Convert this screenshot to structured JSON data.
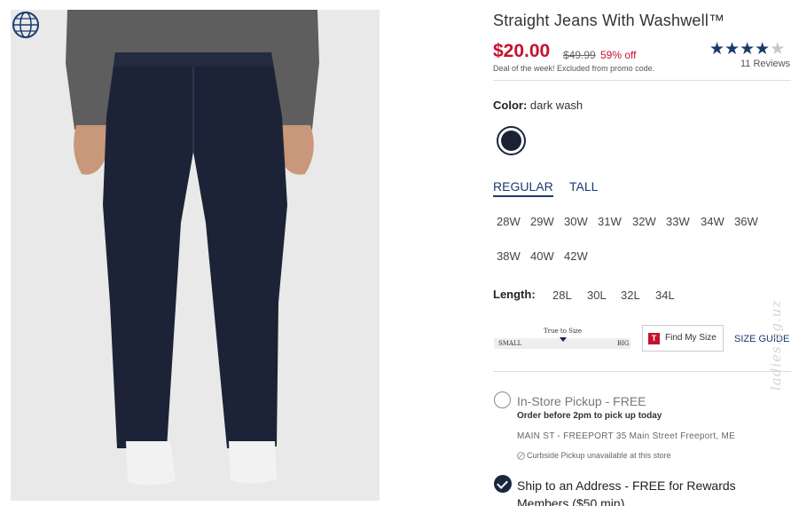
{
  "product": {
    "title": "Straight Jeans With Washwell™",
    "price": "$20.00",
    "original_price": "$49.99",
    "discount": "59% off",
    "deal_note": "Deal of the week! Excluded from promo code.",
    "rating_stars": 4.5,
    "reviews": "11 Reviews"
  },
  "color": {
    "label": "Color:",
    "value": "dark wash",
    "swatch_hex": "#1b2233"
  },
  "fit_tabs": [
    {
      "label": "REGULAR",
      "active": true
    },
    {
      "label": "TALL",
      "active": false
    }
  ],
  "waist_sizes": [
    "28W",
    "29W",
    "30W",
    "31W",
    "32W",
    "33W",
    "34W",
    "36W",
    "38W",
    "40W",
    "42W"
  ],
  "length": {
    "label": "Length:",
    "sizes": [
      "28L",
      "30L",
      "32L",
      "34L"
    ]
  },
  "fit_meter": {
    "label": "True to Size",
    "min_label": "SMALL",
    "max_label": "BIG"
  },
  "find_my_size": {
    "icon_letter": "T",
    "label": "Find My Size"
  },
  "size_guide": "SIZE GUIDE",
  "pickup": {
    "title": "In-Store Pickup - FREE",
    "note": "Order before 2pm to pick up today",
    "address": "MAIN ST - FREEPORT 35 Main Street  Freeport, ME",
    "curbside": "Curbside Pickup unavailable at this store",
    "selected": false
  },
  "shipping": {
    "label": "Ship to an Address - FREE for Rewards Members ($50 min)",
    "selected": true
  },
  "watermark": "ladies.ag.uz",
  "colors": {
    "price_red": "#c8102e",
    "navy": "#1a3a6e",
    "denim": "#1c2336"
  }
}
